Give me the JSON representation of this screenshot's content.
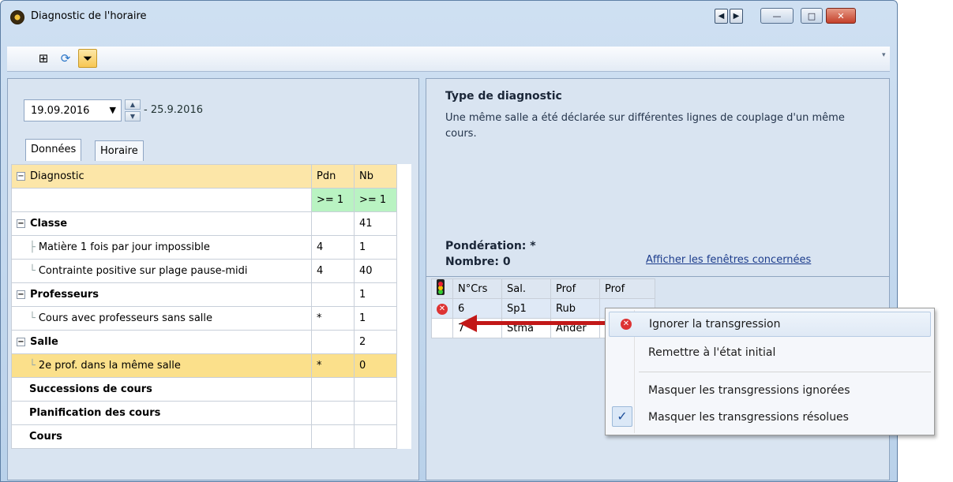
{
  "window": {
    "title": "Diagnostic de l'horaire",
    "nav_prev": "◀",
    "nav_next": "▶",
    "minimize": "—",
    "maximize": "□",
    "close": "✕"
  },
  "toolbar": {
    "icons": [
      "grid-icon",
      "refresh-icon",
      "filter-icon"
    ]
  },
  "left": {
    "date_start": "19.09.2016",
    "date_end": "- 25.9.2016",
    "tabs": [
      "Données",
      "Horaire"
    ],
    "headers": {
      "diagnostic": "Diagnostic",
      "pdn": "Pdn",
      "nb": "Nb"
    },
    "filter_row": {
      "pdn": ">= 1",
      "nb": ">= 1"
    },
    "rows": [
      {
        "label": "Classe",
        "pdn": "",
        "nb": "41"
      },
      {
        "label": "Matière 1 fois par jour impossible",
        "pdn": "4",
        "nb": "1"
      },
      {
        "label": "Contrainte positive sur plage pause-midi",
        "pdn": "4",
        "nb": "40"
      },
      {
        "label": "Professeurs",
        "pdn": "",
        "nb": "1"
      },
      {
        "label": "Cours avec professeurs sans salle",
        "pdn": "*",
        "nb": "1"
      },
      {
        "label": "Salle",
        "pdn": "",
        "nb": "2"
      },
      {
        "label": "2e prof. dans la même salle",
        "pdn": "*",
        "nb": "0"
      },
      {
        "label": "Successions de cours",
        "pdn": "",
        "nb": ""
      },
      {
        "label": "Planification des cours",
        "pdn": "",
        "nb": ""
      },
      {
        "label": "Cours",
        "pdn": "",
        "nb": ""
      }
    ]
  },
  "right": {
    "title": "Type de diagnostic",
    "description": "Une même salle a été déclarée sur différentes lignes de couplage d'un même cours.",
    "ponderation": "Pondération: *",
    "nombre": "Nombre: 0",
    "link": "Afficher les fenêtres concernées",
    "table_headers": [
      "N°Crs",
      "Sal.",
      "Prof",
      "Prof"
    ],
    "table_rows": [
      {
        "crs": "6",
        "sal": "Sp1",
        "prof": "Rub",
        "prof2": ""
      },
      {
        "crs": "7",
        "sal": "Stma",
        "prof": "Ander",
        "prof2": ""
      }
    ]
  },
  "context_menu": {
    "items": [
      "Ignorer la transgression",
      "Remettre à l'état initial",
      "Masquer les transgressions ignorées",
      "Masquer les transgressions résolues"
    ]
  }
}
